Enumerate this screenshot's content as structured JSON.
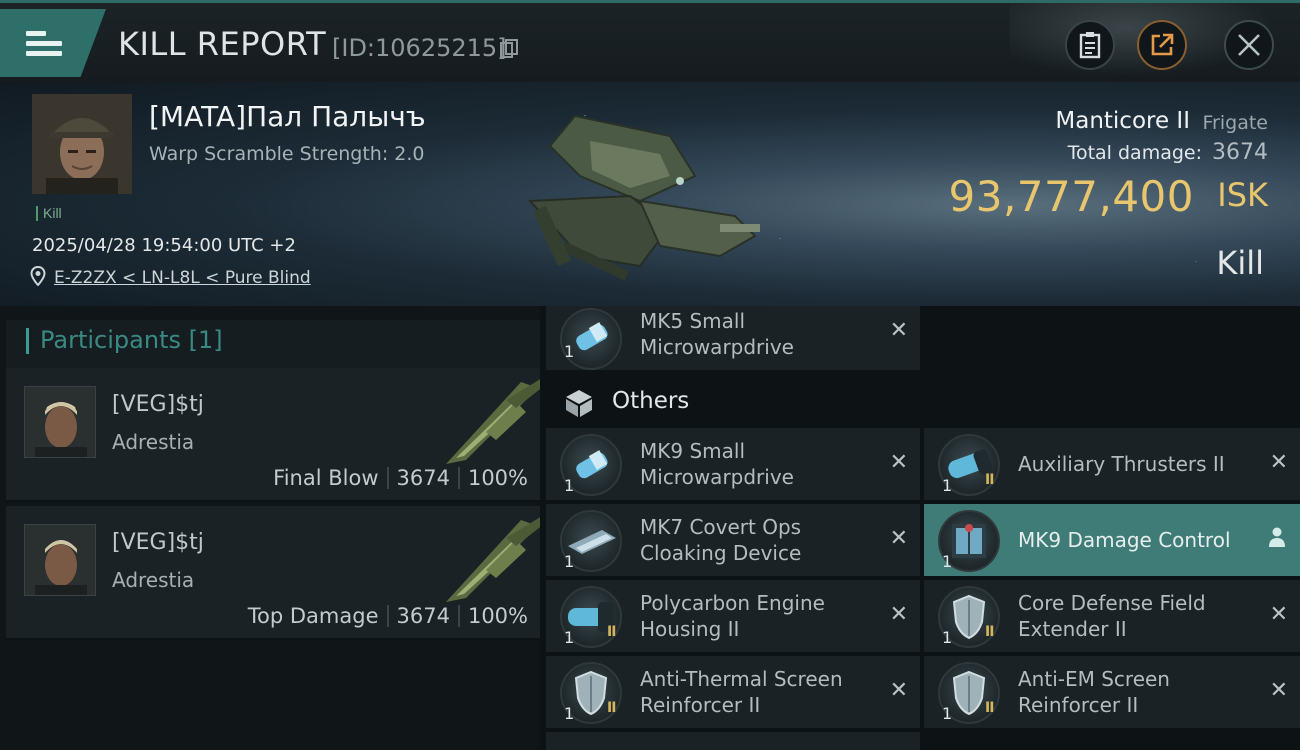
{
  "header": {
    "title": "KILL REPORT",
    "kill_id": "[ID:10625215]"
  },
  "victim": {
    "name": "[MATA]Пал Палычъ",
    "detail": "Warp Scramble Strength: 2.0",
    "tag": "Kill",
    "datetime": "2025/04/28 19:54:00 UTC +2",
    "location": "E-Z2ZX < LN-L8L < Pure Blind",
    "ship_name": "Manticore II",
    "ship_class": "Frigate",
    "total_damage_label": "Total damage:",
    "total_damage": "3674",
    "isk_value": "93,777,400",
    "isk_unit": "ISK",
    "result": "Kill"
  },
  "participants": {
    "header": "Participants [1]",
    "items": [
      {
        "name": "[VEG]$tj",
        "ship": "Adrestia",
        "role": "Final Blow",
        "damage": "3674",
        "percent": "100%"
      },
      {
        "name": "[VEG]$tj",
        "ship": "Adrestia",
        "role": "Top Damage",
        "damage": "3674",
        "percent": "100%"
      }
    ]
  },
  "modules": {
    "top_item": {
      "qty": "1",
      "name_line1": "MK5 Small",
      "name_line2": "Microwarpdrive",
      "mark": "✕"
    },
    "others_label": "Others",
    "items": [
      {
        "qty": "1",
        "tier": "",
        "line1": "MK9 Small",
        "line2": "Microwarpdrive",
        "mark": "✕"
      },
      {
        "qty": "1",
        "tier": "II",
        "line1": "Auxiliary Thrusters II",
        "line2": "",
        "mark": "✕"
      },
      {
        "qty": "1",
        "tier": "",
        "line1": "MK7 Covert Ops",
        "line2": "Cloaking Device",
        "mark": "✕"
      },
      {
        "qty": "1",
        "tier": "",
        "line1": "MK9 Damage Control",
        "line2": "",
        "mark": ""
      },
      {
        "qty": "1",
        "tier": "II",
        "line1": "Polycarbon Engine",
        "line2": "Housing II",
        "mark": "✕"
      },
      {
        "qty": "1",
        "tier": "II",
        "line1": "Core Defense Field",
        "line2": "Extender II",
        "mark": "✕"
      },
      {
        "qty": "1",
        "tier": "II",
        "line1": "Anti-Thermal Screen",
        "line2": "Reinforcer II",
        "mark": "✕"
      },
      {
        "qty": "1",
        "tier": "II",
        "line1": "Anti-EM Screen",
        "line2": "Reinforcer II",
        "mark": "✕"
      }
    ]
  },
  "colors": {
    "accent": "#3d9c94",
    "isk": "#e8c66d",
    "highlight": "#3f7c77"
  }
}
